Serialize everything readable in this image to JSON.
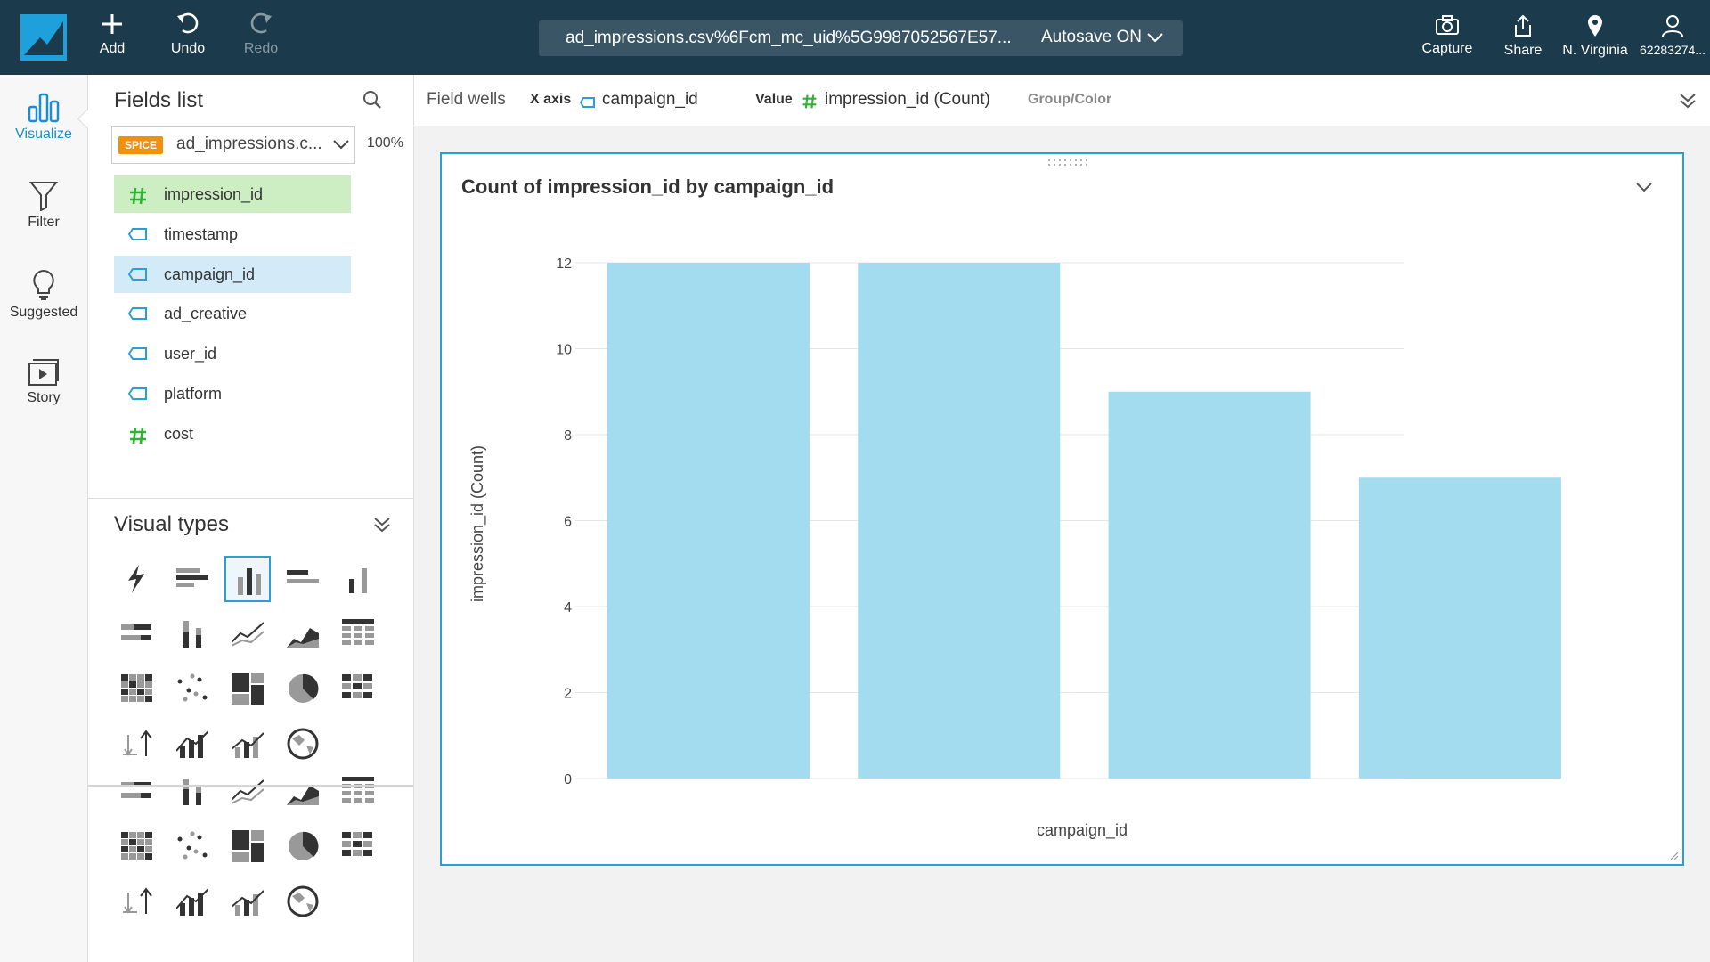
{
  "topbar": {
    "add_label": "Add",
    "undo_label": "Undo",
    "redo_label": "Redo",
    "file_name": "ad_impressions.csv%6Fcm_mc_uid%5G9987052567E57...",
    "autosave_label": "Autosave ON",
    "capture_label": "Capture",
    "share_label": "Share",
    "region_label": "N. Virginia",
    "account_label": "62283274..."
  },
  "nav": {
    "visualize": "Visualize",
    "filter": "Filter",
    "suggested": "Suggested",
    "story": "Story"
  },
  "fields_panel": {
    "title": "Fields list",
    "spice_badge": "SPICE",
    "dataset": "ad_impressions.c...",
    "percent": "100%",
    "fields": [
      {
        "label": "impression_id",
        "type": "numeric"
      },
      {
        "label": "timestamp",
        "type": "dimension"
      },
      {
        "label": "campaign_id",
        "type": "dimension"
      },
      {
        "label": "ad_creative",
        "type": "dimension"
      },
      {
        "label": "user_id",
        "type": "dimension"
      },
      {
        "label": "platform",
        "type": "dimension"
      },
      {
        "label": "cost",
        "type": "numeric"
      }
    ]
  },
  "visual_types": {
    "title": "Visual types"
  },
  "field_wells": {
    "title": "Field wells",
    "x_axis_label": "X axis",
    "x_axis_value": "campaign_id",
    "value_label": "Value",
    "value_value": "impression_id (Count)",
    "group_label": "Group/Color"
  },
  "colors": {
    "topbar": "#1b3a4b",
    "accent": "#2a9fd6",
    "bar": "#a2dcee",
    "numeric_icon": "#2fb135",
    "dimension_icon": "#2a9fd6",
    "spice": "#f0900f"
  },
  "chart_data": {
    "type": "bar",
    "title": "Count of impression_id by campaign_id",
    "xlabel": "campaign_id",
    "ylabel": "impression_id (Count)",
    "categories": [
      "",
      "",
      "",
      ""
    ],
    "values": [
      12,
      12,
      9,
      7
    ],
    "ylim": [
      0,
      12
    ],
    "yticks": [
      0,
      2,
      4,
      6,
      8,
      10,
      12
    ],
    "grid": true
  }
}
